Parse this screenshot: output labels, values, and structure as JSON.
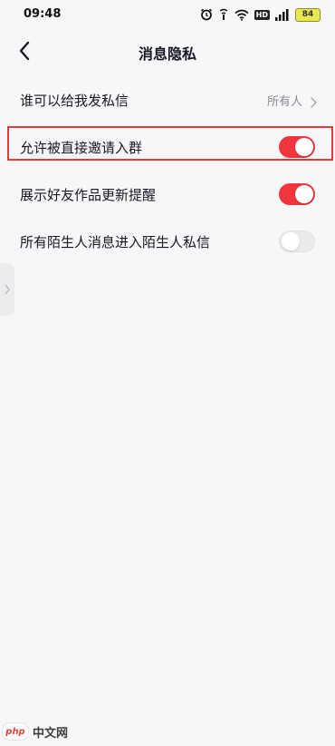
{
  "status_bar": {
    "time": "09:48",
    "network_badge": "HD",
    "battery": "84",
    "icons": [
      "alarm-icon",
      "signal-icon",
      "wifi-icon",
      "hd-icon",
      "cellular-icon",
      "battery-icon"
    ]
  },
  "header": {
    "title": "消息隐私",
    "back_icon": "chevron-left-icon"
  },
  "settings": {
    "who_can_message": {
      "label": "谁可以给我发私信",
      "value": "所有人"
    },
    "allow_group_invite": {
      "label": "允许被直接邀请入群",
      "enabled": true
    },
    "show_friend_updates": {
      "label": "展示好友作品更新提醒",
      "enabled": true
    },
    "stranger_messages": {
      "label": "所有陌生人消息进入陌生人私信",
      "enabled": false
    }
  },
  "colors": {
    "toggle_on": "#f0353f",
    "toggle_off": "#ebebed",
    "highlight": "#e53935",
    "background": "#f7f7f9"
  },
  "watermark": {
    "logo_text": "php",
    "text": "中文网"
  }
}
